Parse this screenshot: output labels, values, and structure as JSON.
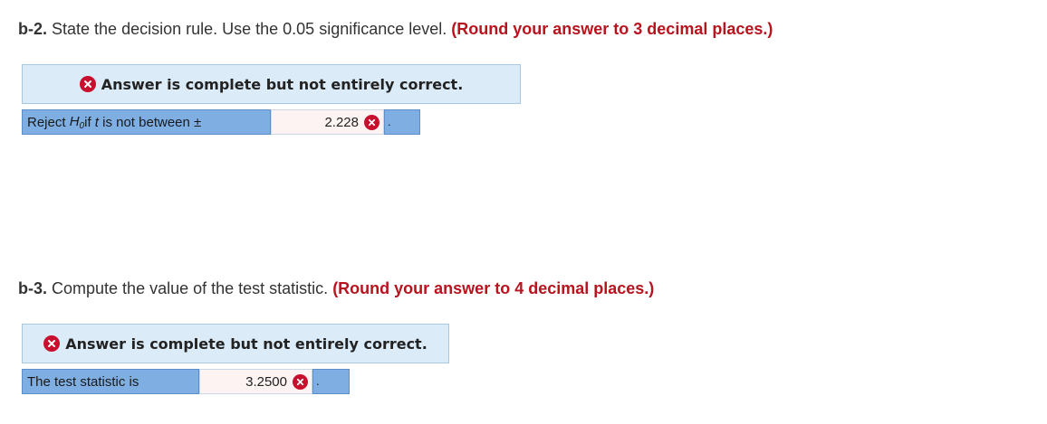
{
  "b2": {
    "number": "b-2.",
    "text": " State the decision rule. Use the 0.05 significance level. ",
    "hint": "(Round your answer to 3 decimal places.)",
    "banner": "Answer is complete but not entirely correct.",
    "label_prefix": "Reject ",
    "label_h": "H",
    "label_sub": "0",
    "label_mid": " if ",
    "label_t": "t",
    "label_suffix": " is not between ±",
    "value": "2.228",
    "tail": "."
  },
  "b3": {
    "number": "b-3.",
    "text": " Compute the value of the test statistic. ",
    "hint": "(Round your answer to 4 decimal places.)",
    "banner": "Answer is complete but not entirely correct.",
    "label": "The test statistic is",
    "value": "3.2500",
    "tail": "."
  },
  "colors": {
    "hint_red": "#b7141e",
    "banner_bg": "#dbebf8",
    "label_blue": "#7faee2",
    "error_red": "#c8102e"
  },
  "icons": {
    "incorrect": "x-circle-icon"
  }
}
